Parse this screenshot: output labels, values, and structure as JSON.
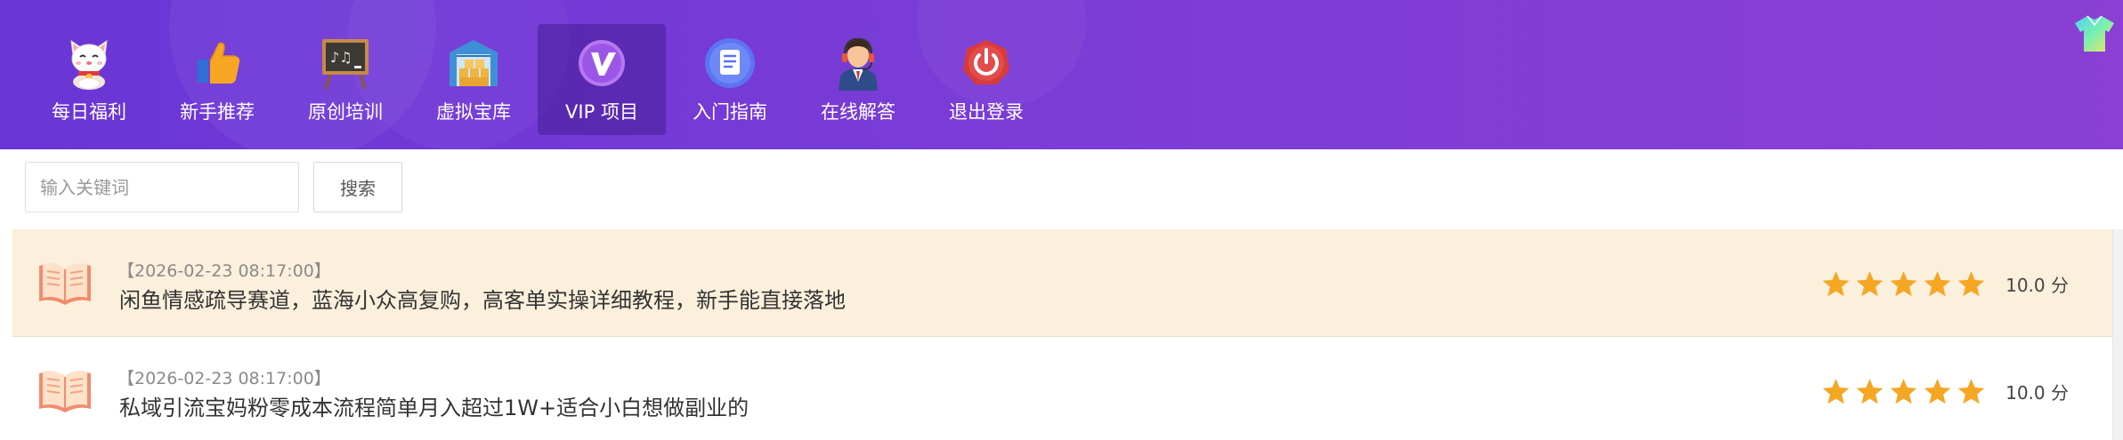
{
  "nav": {
    "items": [
      {
        "label": "每日福利",
        "icon": "lucky-cat-icon",
        "active": false
      },
      {
        "label": "新手推荐",
        "icon": "thumbs-up-icon",
        "active": false
      },
      {
        "label": "原创培训",
        "icon": "chalkboard-icon",
        "active": false
      },
      {
        "label": "虚拟宝库",
        "icon": "warehouse-icon",
        "active": false
      },
      {
        "label": "VIP 项目",
        "icon": "vip-badge-icon",
        "active": true
      },
      {
        "label": "入门指南",
        "icon": "document-icon",
        "active": false
      },
      {
        "label": "在线解答",
        "icon": "support-agent-icon",
        "active": false
      },
      {
        "label": "退出登录",
        "icon": "power-icon",
        "active": false
      }
    ]
  },
  "search": {
    "placeholder": "输入关键词",
    "value": "",
    "button_label": "搜索"
  },
  "list": {
    "items": [
      {
        "date": "【2026-02-23 08:17:00】",
        "title": "闲鱼情感疏导赛道，蓝海小众高复购，高客单实操详细教程，新手能直接落地",
        "stars": 5,
        "score": "10.0 分",
        "highlighted": true
      },
      {
        "date": "【2026-02-23 08:17:00】",
        "title": "私域引流宝妈粉零成本流程简单月入超过1W+适合小白想做副业的",
        "stars": 5,
        "score": "10.0 分",
        "highlighted": false
      }
    ]
  },
  "colors": {
    "nav_gradient_start": "#6a35d6",
    "nav_gradient_end": "#8b3fd3",
    "star": "#f5a623",
    "highlight_row": "#fbf0dc"
  }
}
